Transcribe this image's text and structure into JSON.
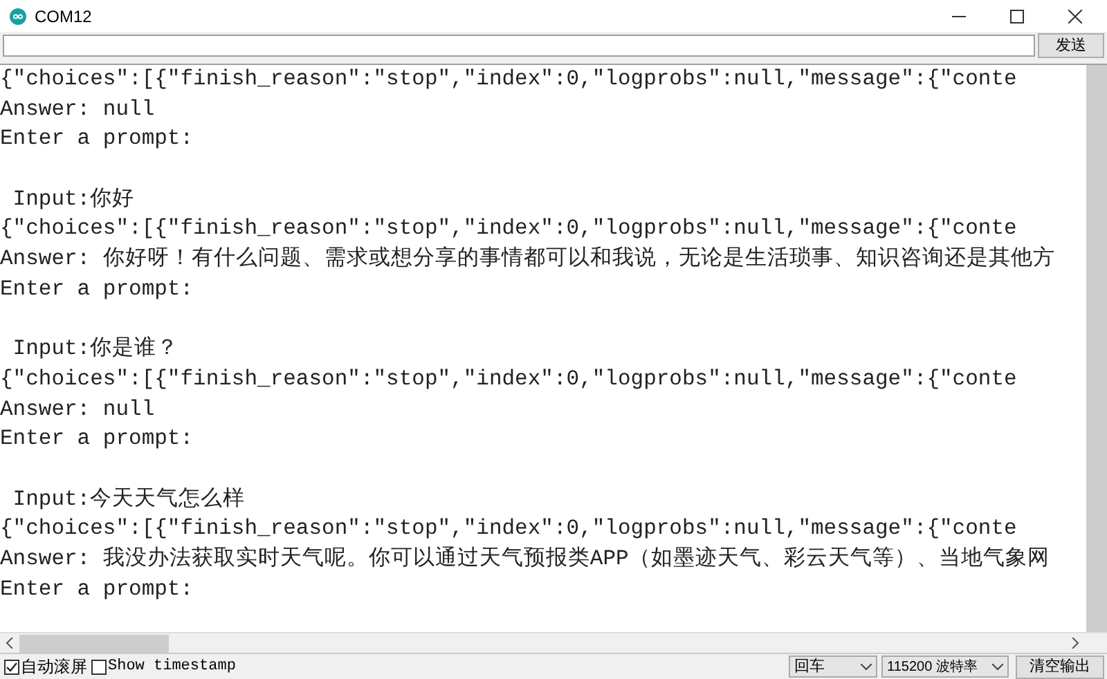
{
  "window": {
    "title": "COM12"
  },
  "send_bar": {
    "send_button": "发送"
  },
  "output_blocks": [
    [
      "{\"choices\":[{\"finish_reason\":\"stop\",\"index\":0,\"logprobs\":null,\"message\":{\"conte",
      "Answer: null",
      "Enter a prompt:"
    ],
    [
      " Input:你好",
      "{\"choices\":[{\"finish_reason\":\"stop\",\"index\":0,\"logprobs\":null,\"message\":{\"conte",
      "Answer: 你好呀！有什么问题、需求或想分享的事情都可以和我说，无论是生活琐事、知识咨询还是其他方",
      "Enter a prompt:"
    ],
    [
      " Input:你是谁？",
      "{\"choices\":[{\"finish_reason\":\"stop\",\"index\":0,\"logprobs\":null,\"message\":{\"conte",
      "Answer: null",
      "Enter a prompt:"
    ],
    [
      " Input:今天天气怎么样",
      "{\"choices\":[{\"finish_reason\":\"stop\",\"index\":0,\"logprobs\":null,\"message\":{\"conte",
      "Answer: 我没办法获取实时天气呢。你可以通过天气预报类APP（如墨迹天气、彩云天气等）、当地气象网",
      "Enter a prompt:"
    ]
  ],
  "bottom_bar": {
    "options": [
      {
        "label": "自动滚屏",
        "checked": true
      },
      {
        "label": "Show timestamp",
        "checked": false
      }
    ],
    "line_ending": "回车",
    "baud_rate": "115200 波特率",
    "clear_button": "清空输出"
  }
}
